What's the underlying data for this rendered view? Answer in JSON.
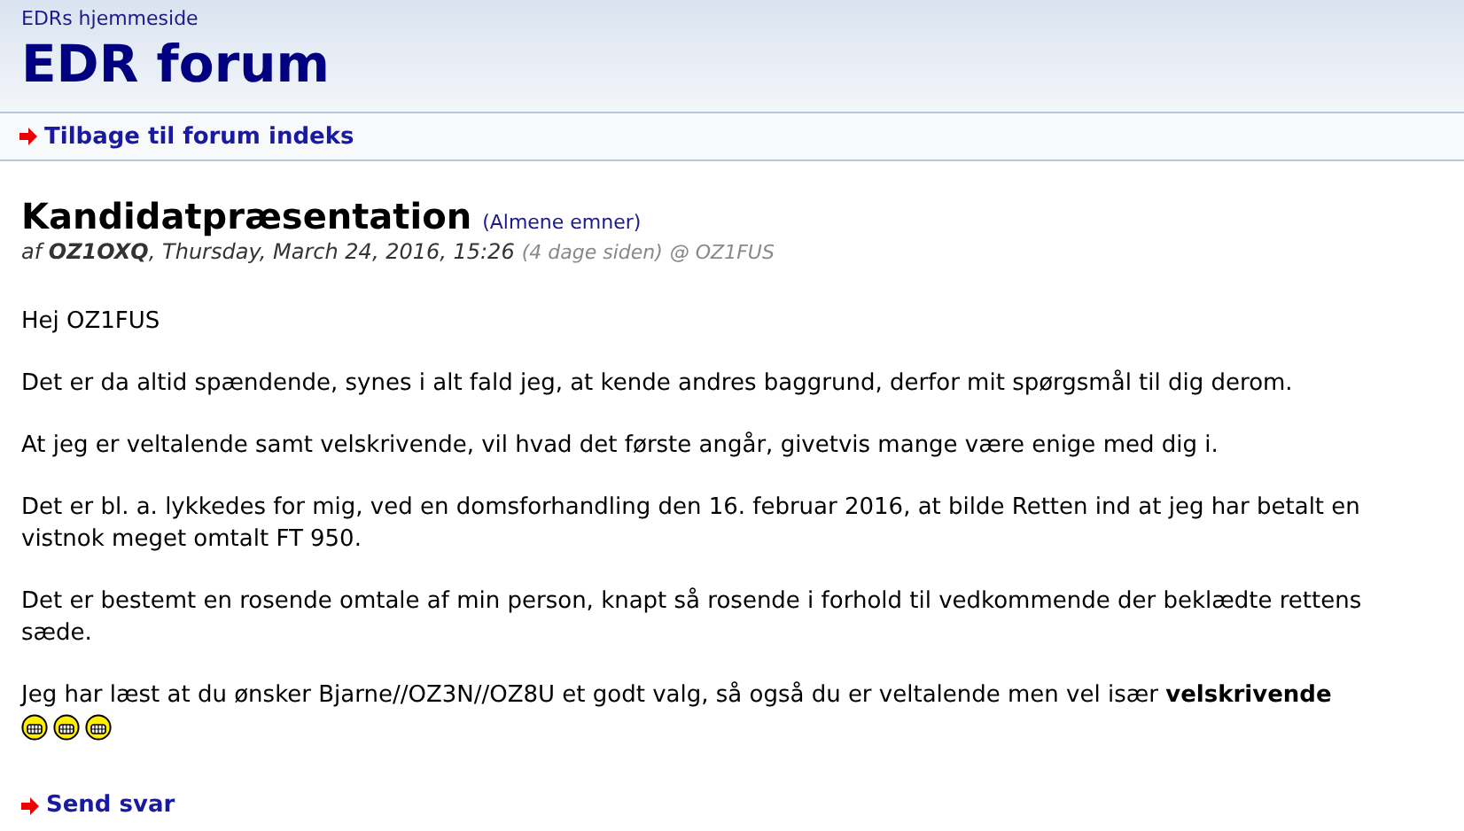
{
  "header": {
    "home_link": "EDRs hjemmeside",
    "title": "EDR forum"
  },
  "nav": {
    "back_link": "Tilbage til forum indeks"
  },
  "post": {
    "subject": "Kandidatpræsentation",
    "category": "(Almene emner)",
    "meta": "af **OZ1OXQ**, Thursday, March 24, 2016, 15:26",
    "age": "(4 dage siden)",
    "reply_to": "@ OZ1FUS",
    "paragraphs": [
      "Hej OZ1FUS",
      "Det er da altid spændende, synes i alt fald jeg, at kende andres baggrund, derfor mit spørgsmål til dig derom.",
      "At jeg er veltalende samt velskrivende, vil hvad det første angår, givetvis mange være enige med dig i.",
      "Det er bl. a. lykkedes for mig, ved en domsforhandling den 16. februar 2016, at bilde Retten ind at jeg har betalt en vistnok meget omtalt FT 950.",
      "Det er bestemt en rosende omtale af min person, knapt så rosende i forhold til vedkommende der beklædte rettens sæde.",
      "Jeg har læst at du ønsker Bjarne//OZ3N//OZ8U et godt valg, så også du er veltalende men vel især **velskrivende**"
    ],
    "smileys": [
      {
        "kind": "grin"
      },
      {
        "kind": "grin"
      },
      {
        "kind": "grin"
      }
    ]
  },
  "footer": {
    "reply_link": "Send svar"
  }
}
